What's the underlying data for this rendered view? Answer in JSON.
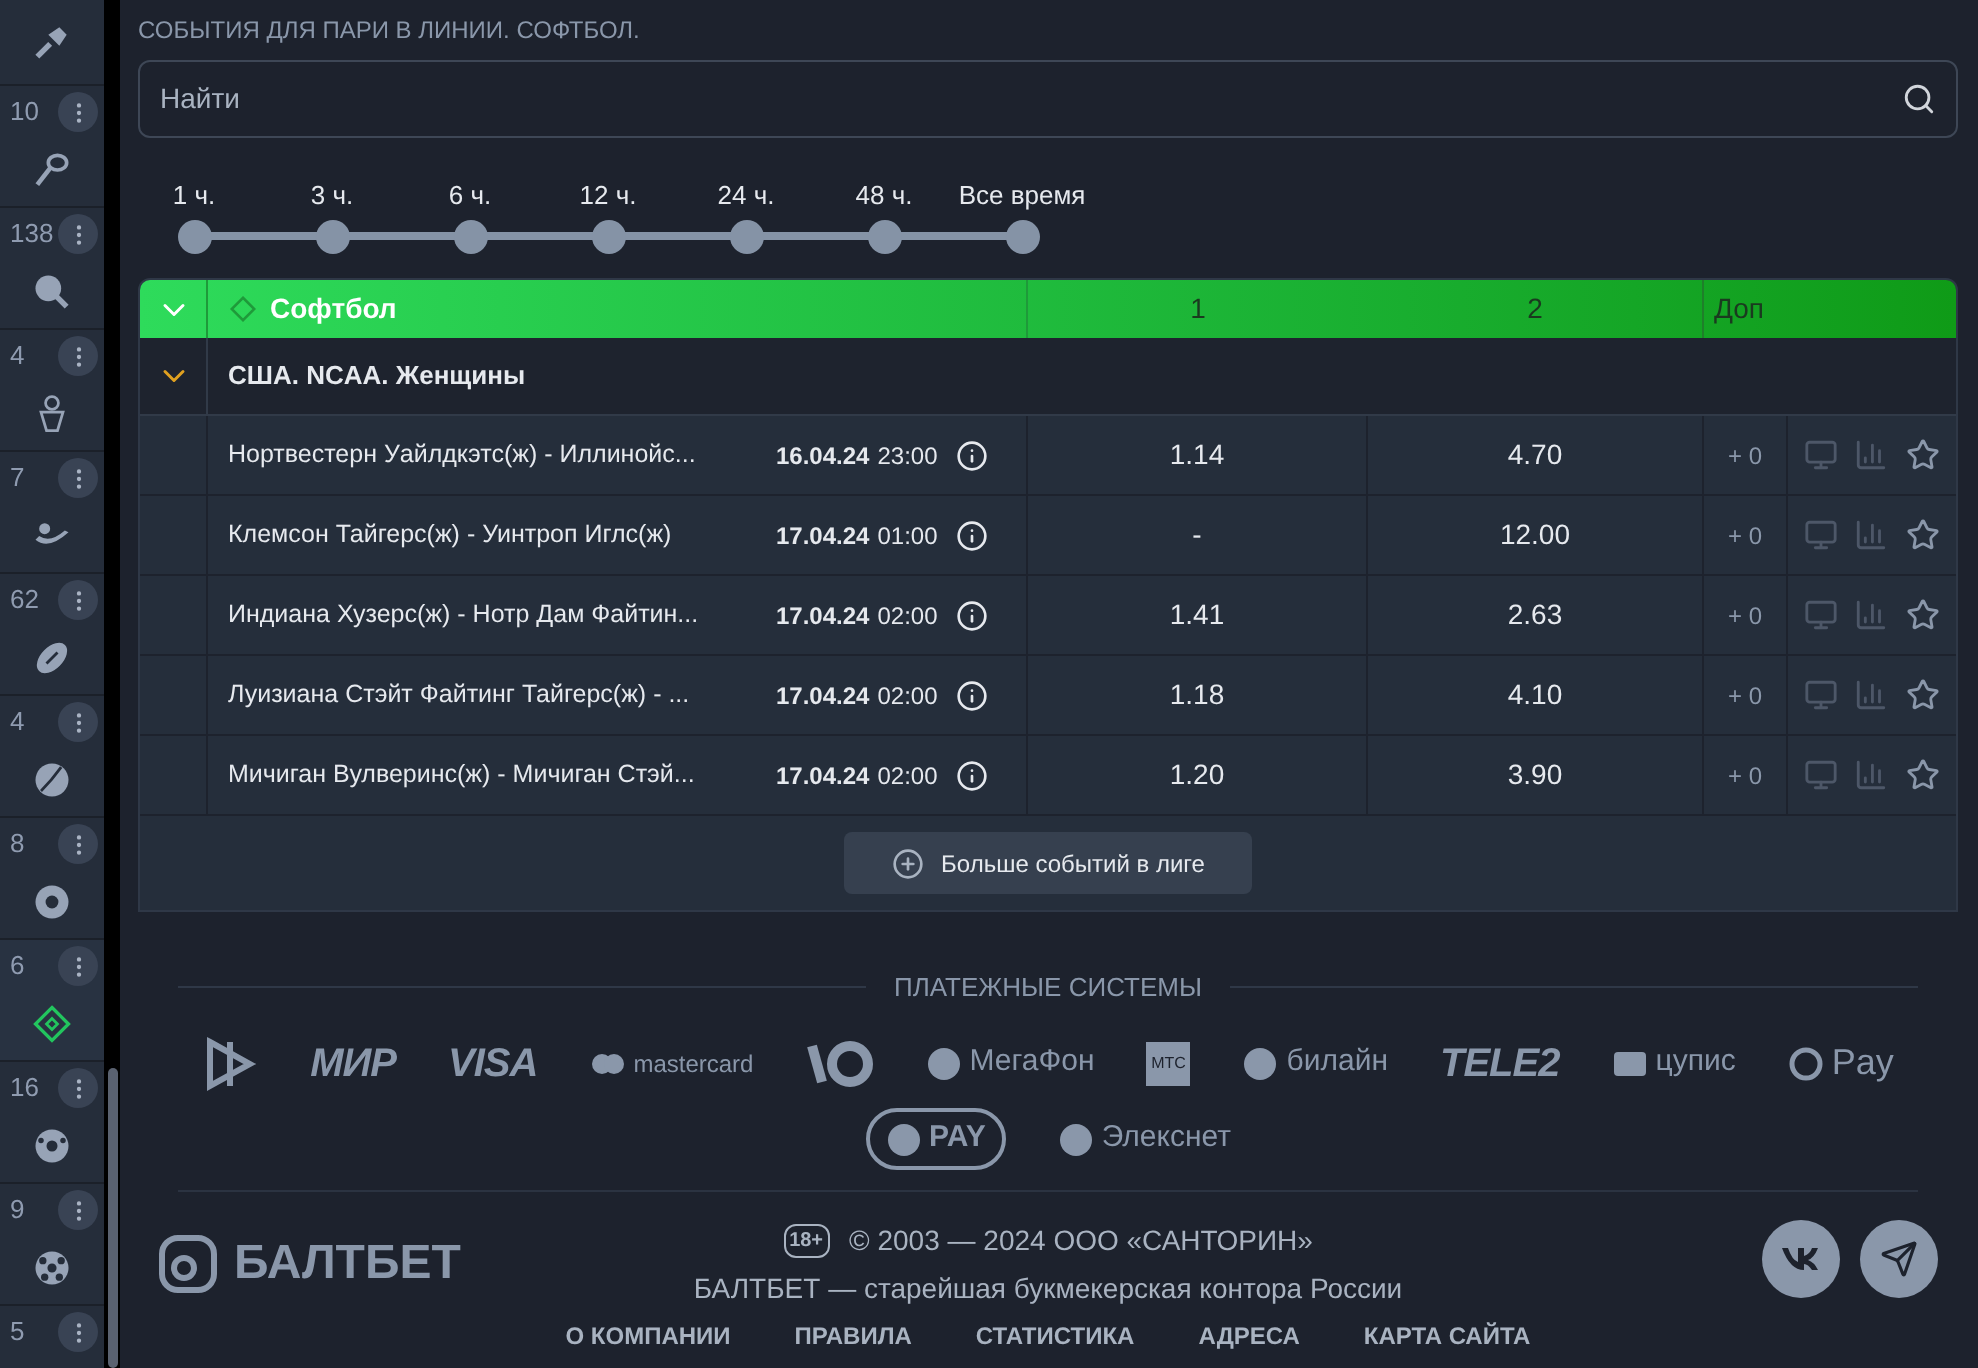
{
  "sidebar": {
    "items": [
      {
        "selected": false
      },
      {
        "count": "10",
        "selected": false
      },
      {
        "count": "138",
        "selected": false
      },
      {
        "count": "4",
        "selected": false
      },
      {
        "count": "7",
        "selected": false
      },
      {
        "count": "62",
        "selected": false
      },
      {
        "count": "4",
        "selected": false
      },
      {
        "count": "8",
        "selected": false
      },
      {
        "count": "6",
        "selected": true
      },
      {
        "count": "16",
        "selected": false
      },
      {
        "count": "9",
        "selected": false
      },
      {
        "count": "5"
      }
    ]
  },
  "page_title": "СОБЫТИЯ ДЛЯ ПАРИ В ЛИНИИ. СОФТБОЛ.",
  "search": {
    "placeholder": "Найти"
  },
  "time_filter": {
    "stops": [
      "1 ч.",
      "3 ч.",
      "6 ч.",
      "12 ч.",
      "24 ч.",
      "48 ч.",
      "Все время"
    ]
  },
  "table": {
    "sport": "Софтбол",
    "columns": [
      "1",
      "2",
      "Доп"
    ],
    "league": {
      "name": "США. NCAA. Женщины",
      "expanded": true
    },
    "rows": [
      {
        "event": "Нортвестерн Уайлдкэтс(ж) - Иллинойс...",
        "date": "16.04.24",
        "time": "23:00",
        "odd_1": "1.14",
        "odd_2": "4.70",
        "extra": "+ 0"
      },
      {
        "event": "Клемсон Тайгерс(ж) - Уинтроп Иглс(ж)",
        "date": "17.04.24",
        "time": "01:00",
        "odd_1": "-",
        "odd_2": "12.00",
        "extra": "+ 0"
      },
      {
        "event": "Индиана Хузерс(ж) - Нотр Дам Файтин...",
        "date": "17.04.24",
        "time": "02:00",
        "odd_1": "1.41",
        "odd_2": "2.63",
        "extra": "+ 0"
      },
      {
        "event": "Луизиана Стэйт Файтинг Тайгерс(ж) - ...",
        "date": "17.04.24",
        "time": "02:00",
        "odd_1": "1.18",
        "odd_2": "4.10",
        "extra": "+ 0"
      },
      {
        "event": "Мичиган Вулверинс(ж) - Мичиган Стэй...",
        "date": "17.04.24",
        "time": "02:00",
        "odd_1": "1.20",
        "odd_2": "3.90",
        "extra": "+ 0"
      }
    ],
    "more_button": "Больше событий в лиге"
  },
  "footer": {
    "payments_title": "ПЛАТЕЖНЫЕ СИСТЕМЫ",
    "payment_rows": [
      [
        {
          "kind": "symbol"
        },
        {
          "kind": "wordmark",
          "label": "МИР"
        },
        {
          "kind": "wordmark",
          "label": "VISA"
        },
        {
          "kind": "icon-text",
          "label": "mastercard"
        },
        {
          "kind": "symbol"
        },
        {
          "kind": "icon-text",
          "label": "МегаФон"
        },
        {
          "kind": "boxed",
          "label": "МТС"
        },
        {
          "kind": "icon-text",
          "label": "билайн"
        },
        {
          "kind": "wordmark",
          "label": "TELE2"
        },
        {
          "kind": "icon-text",
          "label": "цупис"
        },
        {
          "kind": "icon-text",
          "label": "Pay"
        }
      ],
      [
        {
          "kind": "pill",
          "label": "PAY"
        },
        {
          "kind": "icon-text",
          "label": "Элекснет"
        }
      ]
    ],
    "brand": "БАЛТБЕТ",
    "age": "18+",
    "copyright": "© 2003 — 2024  ООО «САНТОРИН»",
    "tagline": "БАЛТБЕТ — старейшая букмекерская контора России",
    "links": [
      "О КОМПАНИИ",
      "ПРАВИЛА",
      "СТАТИСТИКА",
      "АДРЕСА",
      "КАРТА САЙТА"
    ]
  }
}
